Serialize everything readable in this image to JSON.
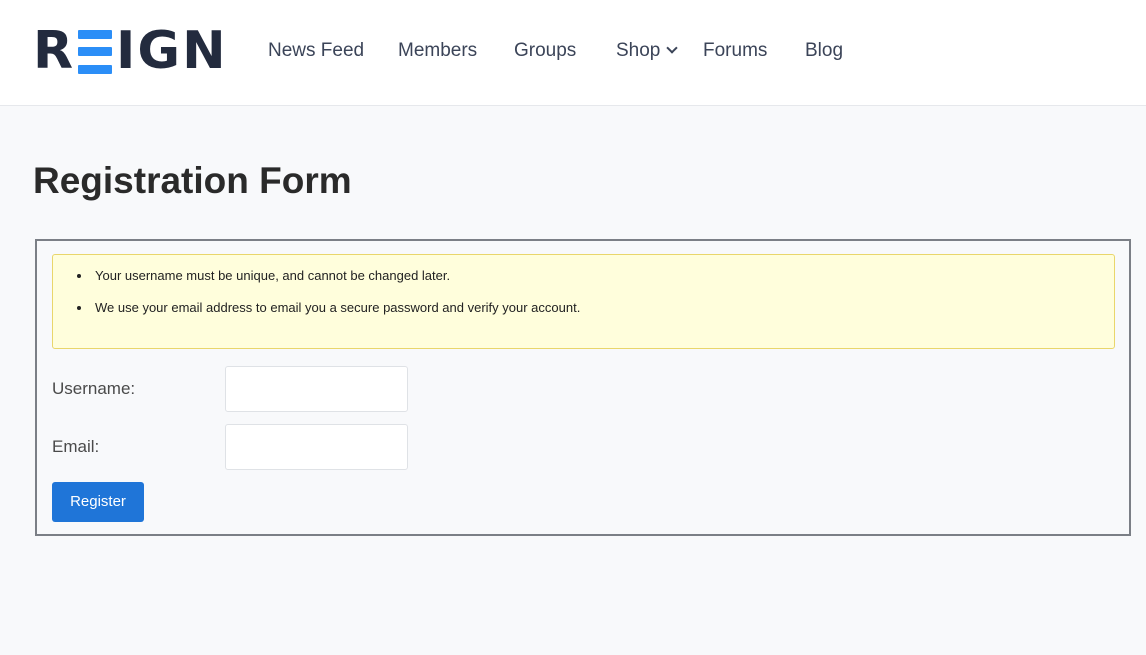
{
  "header": {
    "logo_left": "R",
    "logo_right": "IGN",
    "logo_text": "REIGN",
    "nav": [
      {
        "label": "News Feed"
      },
      {
        "label": "Members"
      },
      {
        "label": "Groups"
      },
      {
        "label": "Shop",
        "has_dropdown": true
      },
      {
        "label": "Forums"
      },
      {
        "label": "Blog"
      }
    ]
  },
  "page": {
    "title": "Registration Form"
  },
  "notice": {
    "items": [
      "Your username must be unique, and cannot be changed later.",
      "We use your email address to email you a secure password and verify your account."
    ]
  },
  "form": {
    "username_label": "Username:",
    "username_value": "",
    "email_label": "Email:",
    "email_value": "",
    "register_label": "Register"
  },
  "colors": {
    "brand_dark": "#232b3e",
    "brand_accent": "#2b8ef7",
    "button": "#1f75d8",
    "notice_bg": "#fffedc",
    "notice_border": "#e9d66b"
  }
}
